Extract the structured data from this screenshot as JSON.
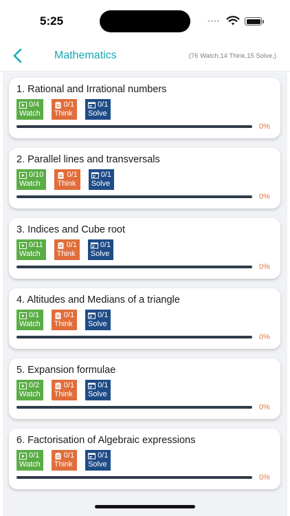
{
  "status": {
    "time": "5:25"
  },
  "header": {
    "title": "Mathematics",
    "summary": "(76 Watch,14 Think,15 Solve,)"
  },
  "colors": {
    "accent": "#14a8b4",
    "watch": "#5aad45",
    "think": "#e06d3a",
    "solve": "#1e4c87",
    "percent": "#e07a3e"
  },
  "chapters": [
    {
      "title": "1. Rational and Irrational numbers",
      "watch_count": "0/4",
      "watch_label": "Watch",
      "think_count": "0/1",
      "think_label": "Think",
      "solve_count": "0/1",
      "solve_label": "Solve",
      "progress": 0,
      "percent": "0%"
    },
    {
      "title": "2. Parallel lines and transversals",
      "watch_count": "0/10",
      "watch_label": "Watch",
      "think_count": "0/1",
      "think_label": "Think",
      "solve_count": "0/1",
      "solve_label": "Solve",
      "progress": 0,
      "percent": "0%"
    },
    {
      "title": "3. Indices and Cube root",
      "watch_count": "0/11",
      "watch_label": "Watch",
      "think_count": "0/1",
      "think_label": "Think",
      "solve_count": "0/1",
      "solve_label": "Solve",
      "progress": 0,
      "percent": "0%"
    },
    {
      "title": "4. Altitudes and Medians of a triangle",
      "watch_count": "0/1",
      "watch_label": "Watch",
      "think_count": "0/1",
      "think_label": "Think",
      "solve_count": "0/1",
      "solve_label": "Solve",
      "progress": 0,
      "percent": "0%"
    },
    {
      "title": "5. Expansion formulae",
      "watch_count": "0/2",
      "watch_label": "Watch",
      "think_count": "0/1",
      "think_label": "Think",
      "solve_count": "0/1",
      "solve_label": "Solve",
      "progress": 0,
      "percent": "0%"
    },
    {
      "title": "6. Factorisation of Algebraic expressions",
      "watch_count": "0/1",
      "watch_label": "Watch",
      "think_count": "0/1",
      "think_label": "Think",
      "solve_count": "0/1",
      "solve_label": "Solve",
      "progress": 0,
      "percent": "0%"
    }
  ]
}
